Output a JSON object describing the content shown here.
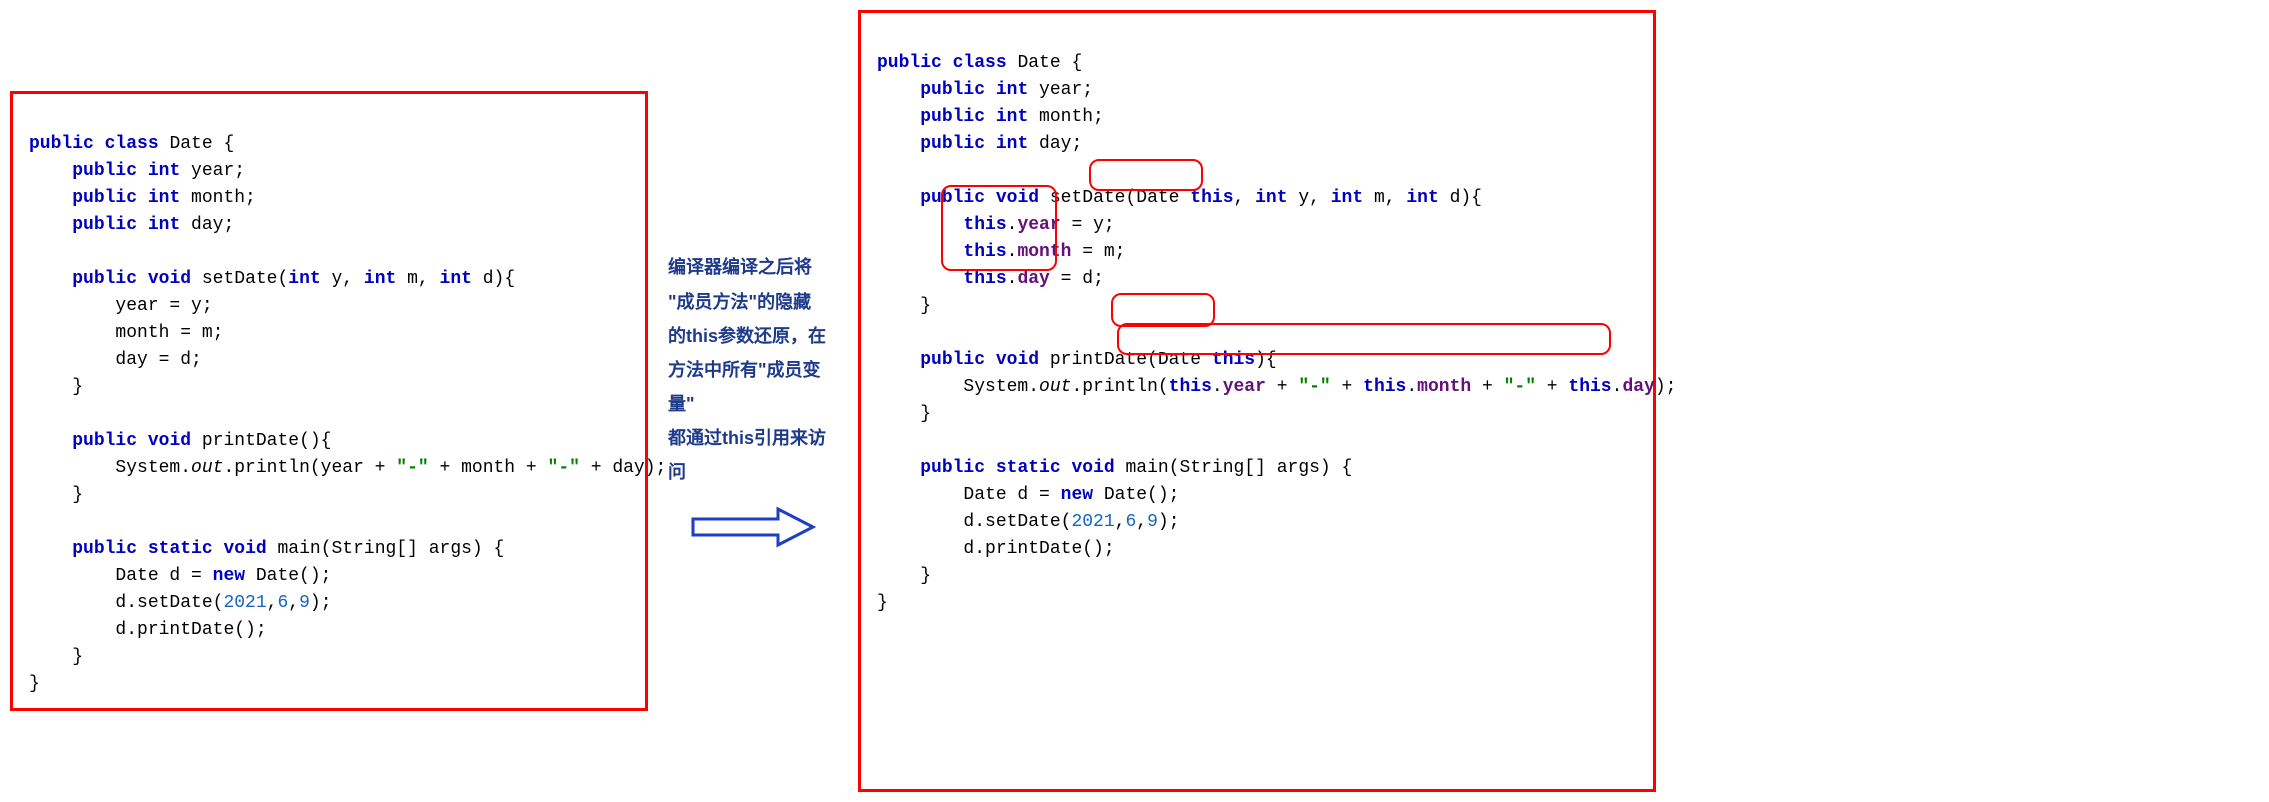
{
  "left_code": {
    "l1_kw1": "public",
    "l1_kw2": "class",
    "l1_rest": " Date {",
    "l2_kw1": "public",
    "l2_kw2": "int",
    "l2_rest": " year;",
    "l3_kw1": "public",
    "l3_kw2": "int",
    "l3_rest": " month;",
    "l4_kw1": "public",
    "l4_kw2": "int",
    "l4_rest": " day;",
    "l6_kw1": "public",
    "l6_kw2": "void",
    "l6_meth": " setDate(",
    "l6_kw3": "int",
    "l6_p1": " y, ",
    "l6_kw4": "int",
    "l6_p2": " m, ",
    "l6_kw5": "int",
    "l6_p3": " d){",
    "l7": "year = y;",
    "l8": "month = m;",
    "l9": "day = d;",
    "l10": "}",
    "l12_kw1": "public",
    "l12_kw2": "void",
    "l12_rest": " printDate(){",
    "l13_a": "System.",
    "l13_out": "out",
    "l13_b": ".println(year + ",
    "l13_s1": "\"-\"",
    "l13_c": " + month + ",
    "l13_s2": "\"-\"",
    "l13_d": " + day);",
    "l14": "}",
    "l16_kw1": "public",
    "l16_kw2": "static",
    "l16_kw3": "void",
    "l16_rest": " main(String[] args) {",
    "l17_a": "Date d = ",
    "l17_kw": "new",
    "l17_b": " Date();",
    "l18_a": "d.setDate(",
    "l18_n1": "2021",
    "l18_c1": ",",
    "l18_n2": "6",
    "l18_c2": ",",
    "l18_n3": "9",
    "l18_b": ");",
    "l19": "d.printDate();",
    "l20": "}",
    "l21": "}"
  },
  "explanation": "编译器编译之后将\n\"成员方法\"的隐藏\n的this参数还原，在\n方法中所有\"成员变量\"\n都通过this引用来访问",
  "right_code": {
    "l1_kw1": "public",
    "l1_kw2": "class",
    "l1_rest": " Date {",
    "l2_kw1": "public",
    "l2_kw2": "int",
    "l2_rest": " year;",
    "l3_kw1": "public",
    "l3_kw2": "int",
    "l3_rest": " month;",
    "l4_kw1": "public",
    "l4_kw2": "int",
    "l4_rest": " day;",
    "l6_kw1": "public",
    "l6_kw2": "void",
    "l6_meth": " setDate(Date ",
    "l6_this": "this",
    "l6_c": ", ",
    "l6_kw3": "int",
    "l6_p1": " y, ",
    "l6_kw4": "int",
    "l6_p2": " m, ",
    "l6_kw5": "int",
    "l6_p3": " d){",
    "l7_this": "this",
    "l7_dot": ".",
    "l7_fld": "year",
    "l7_rest": " = y;",
    "l8_this": "this",
    "l8_dot": ".",
    "l8_fld": "month",
    "l8_rest": " = m;",
    "l9_this": "this",
    "l9_dot": ".",
    "l9_fld": "day",
    "l9_rest": " = d;",
    "l10": "}",
    "l12_kw1": "public",
    "l12_kw2": "void",
    "l12_rest": " printDate(Date ",
    "l12_this": "this",
    "l12_end": "){",
    "l13_a": "System.",
    "l13_out": "out",
    "l13_b": ".println(",
    "l13_t1": "this",
    "l13_d1": ".",
    "l13_f1": "year",
    "l13_c1": " + ",
    "l13_s1": "\"-\"",
    "l13_c2": " + ",
    "l13_t2": "this",
    "l13_d2": ".",
    "l13_f2": "month",
    "l13_c3": " + ",
    "l13_s2": "\"-\"",
    "l13_c4": " + ",
    "l13_t3": "this",
    "l13_d3": ".",
    "l13_f3": "day",
    "l13_end": ");",
    "l14": "}",
    "l16_kw1": "public",
    "l16_kw2": "static",
    "l16_kw3": "void",
    "l16_rest": " main(String[] args) {",
    "l17_a": "Date d = ",
    "l17_kw": "new",
    "l17_b": " Date();",
    "l18_a": "d.setDate(",
    "l18_n1": "2021",
    "l18_c1": ",",
    "l18_n2": "6",
    "l18_c2": ",",
    "l18_n3": "9",
    "l18_b": ");",
    "l19": "d.printDate();",
    "l20": "}",
    "l21": "}"
  }
}
